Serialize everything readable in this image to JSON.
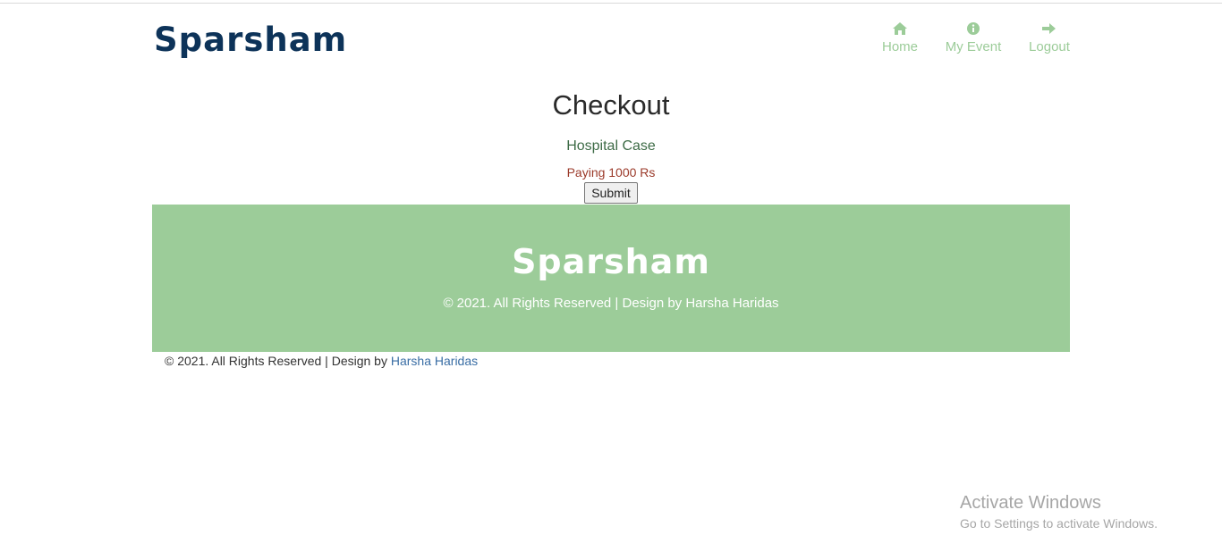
{
  "brand": {
    "logo_text": "Sparsham",
    "color": "#0d3359"
  },
  "nav": {
    "items": [
      {
        "label": "Home",
        "icon": "home-icon"
      },
      {
        "label": "My Event",
        "icon": "info-icon"
      },
      {
        "label": "Logout",
        "icon": "arrow-right-icon"
      }
    ],
    "color": "#9ccc99"
  },
  "checkout": {
    "title": "Checkout",
    "case_name": "Hospital Case",
    "paying_text": "Paying 1000 Rs",
    "submit_label": "Submit"
  },
  "footer": {
    "logo_text": "Sparsham",
    "copyright": "© 2021. All Rights Reserved | Design by Harsha Haridas",
    "background": "#9ccc99"
  },
  "bottom": {
    "copyright_prefix": "© 2021. All Rights Reserved | Design by",
    "author_link": "Harsha Haridas"
  },
  "watermark": {
    "title": "Activate Windows",
    "subtitle": "Go to Settings to activate Windows."
  }
}
